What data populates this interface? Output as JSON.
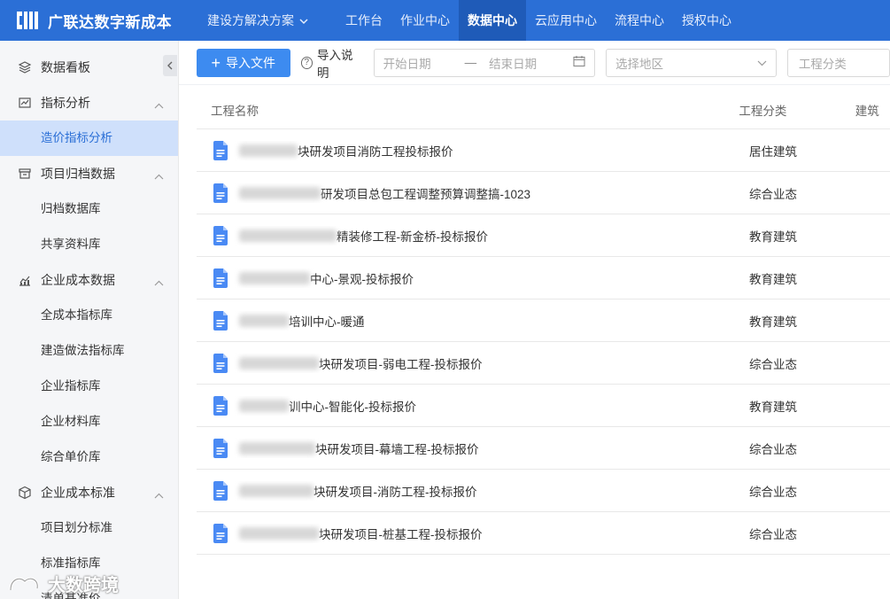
{
  "app": {
    "title": "广联达数字新成本"
  },
  "header": {
    "solution_label": "建设方解决方案",
    "nav": [
      "工作台",
      "作业中心",
      "数据中心",
      "云应用中心",
      "流程中心",
      "授权中心"
    ],
    "active_nav": "数据中心"
  },
  "sidebar": {
    "items": [
      {
        "type": "group",
        "label": "数据看板",
        "icon": "layers-icon"
      },
      {
        "type": "group",
        "label": "指标分析",
        "icon": "chart-icon",
        "expanded": true
      },
      {
        "type": "item",
        "label": "造价指标分析",
        "active": true
      },
      {
        "type": "group",
        "label": "项目归档数据",
        "icon": "archive-icon",
        "expanded": true
      },
      {
        "type": "item",
        "label": "归档数据库"
      },
      {
        "type": "item",
        "label": "共享资料库"
      },
      {
        "type": "group",
        "label": "企业成本数据",
        "icon": "trend-icon",
        "expanded": true
      },
      {
        "type": "item",
        "label": "全成本指标库"
      },
      {
        "type": "item",
        "label": "建造做法指标库"
      },
      {
        "type": "item",
        "label": "企业指标库"
      },
      {
        "type": "item",
        "label": "企业材料库"
      },
      {
        "type": "item",
        "label": "综合单价库"
      },
      {
        "type": "group",
        "label": "企业成本标准",
        "icon": "cube-icon",
        "expanded": true
      },
      {
        "type": "item",
        "label": "项目划分标准"
      },
      {
        "type": "item",
        "label": "标准指标库"
      },
      {
        "type": "item",
        "label": "清单基准价"
      }
    ]
  },
  "toolbar": {
    "import_label": "导入文件",
    "help_label": "导入说明",
    "start_date_placeholder": "开始日期",
    "end_date_placeholder": "结束日期",
    "date_separator": "—",
    "region_placeholder": "选择地区",
    "category_placeholder": "工程分类"
  },
  "table": {
    "columns": [
      "工程名称",
      "工程分类",
      "建筑"
    ],
    "rows": [
      {
        "name": "块研发项目消防工程投标报价",
        "category": "居住建筑"
      },
      {
        "name": "研发项目总包工程调整预算调整搞-1023",
        "category": "综合业态"
      },
      {
        "name": "精装修工程-新金桥-投标报价",
        "category": "教育建筑"
      },
      {
        "name": "中心-景观-投标报价",
        "category": "教育建筑"
      },
      {
        "name": "培训中心-暖通",
        "category": "教育建筑"
      },
      {
        "name": "块研发项目-弱电工程-投标报价",
        "category": "综合业态"
      },
      {
        "name": "训中心-智能化-投标报价",
        "category": "教育建筑"
      },
      {
        "name": "块研发项目-幕墙工程-投标报价",
        "category": "综合业态"
      },
      {
        "name": "块研发项目-消防工程-投标报价",
        "category": "综合业态"
      },
      {
        "name": "块研发项目-桩基工程-投标报价",
        "category": "综合业态"
      }
    ]
  },
  "watermark": {
    "text": "大数跨境"
  },
  "colors": {
    "brand": "#2b6fd6",
    "active_nav": "#1f5bb8",
    "button": "#3d8bf0",
    "sidebar_active": "#cfe0fb"
  }
}
